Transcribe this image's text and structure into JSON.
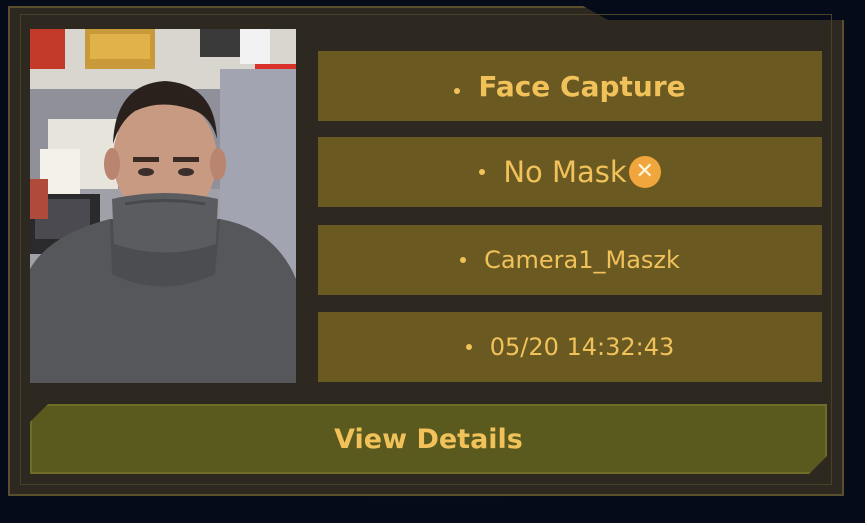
{
  "capture": {
    "title": "Face Capture",
    "status": "No Mask",
    "status_icon": "close-circle-icon",
    "camera": "Camera1_Maszk",
    "timestamp": "05/20 14:32:43",
    "photo_description_icon": "captured-face-photo"
  },
  "actions": {
    "view_details_label": "View Details"
  },
  "colors": {
    "accent_text": "#f2c25a",
    "row_background": "#6a5a22",
    "button_background": "#5a5a1e",
    "panel_background": "#2d2920",
    "status_badge": "#f0a63c"
  }
}
